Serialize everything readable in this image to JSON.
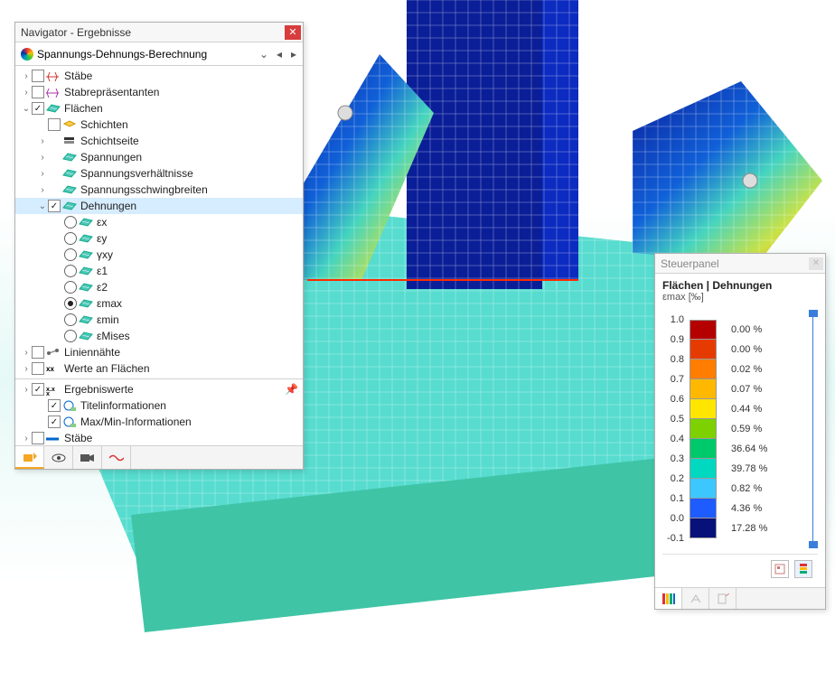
{
  "navigator": {
    "title": "Navigator - Ergebnisse",
    "dropdown": "Spannungs-Dehnungs-Berechnung",
    "tree": [
      {
        "d": 0,
        "exp": ">",
        "chk": false,
        "icon": "beam",
        "label": "Stäbe"
      },
      {
        "d": 0,
        "exp": ">",
        "chk": false,
        "icon": "beam2",
        "label": "Stabrepräsentanten"
      },
      {
        "d": 0,
        "exp": "v",
        "chk": true,
        "icon": "surf",
        "label": "Flächen"
      },
      {
        "d": 1,
        "chk": false,
        "icon": "layer",
        "label": "Schichten"
      },
      {
        "d": 1,
        "exp": ">",
        "icon": "side",
        "label": "Schichtseite"
      },
      {
        "d": 1,
        "exp": ">",
        "icon": "surf",
        "label": "Spannungen"
      },
      {
        "d": 1,
        "exp": ">",
        "icon": "surf",
        "label": "Spannungsverhältnisse"
      },
      {
        "d": 1,
        "exp": ">",
        "icon": "surf",
        "label": "Spannungsschwingbreiten"
      },
      {
        "d": 1,
        "exp": "v",
        "chk": true,
        "icon": "surf",
        "label": "Dehnungen",
        "sel": true
      },
      {
        "d": 2,
        "radio": false,
        "icon": "surf",
        "label": "εx"
      },
      {
        "d": 2,
        "radio": false,
        "icon": "surf",
        "label": "εy"
      },
      {
        "d": 2,
        "radio": false,
        "icon": "surf",
        "label": "γxy"
      },
      {
        "d": 2,
        "radio": false,
        "icon": "surf",
        "label": "ε1"
      },
      {
        "d": 2,
        "radio": false,
        "icon": "surf",
        "label": "ε2"
      },
      {
        "d": 2,
        "radio": true,
        "icon": "surf",
        "label": "εmax"
      },
      {
        "d": 2,
        "radio": false,
        "icon": "surf",
        "label": "εmin"
      },
      {
        "d": 2,
        "radio": false,
        "icon": "surf",
        "label": "εMises"
      },
      {
        "d": 0,
        "exp": ">",
        "chk": false,
        "icon": "line",
        "label": "Liniennähte"
      },
      {
        "d": 0,
        "exp": ">",
        "chk": false,
        "icon": "xx",
        "label": "Werte an Flächen"
      },
      {
        "divider": true
      },
      {
        "d": 0,
        "exp": ">",
        "chk": true,
        "icon": "xxx",
        "label": "Ergebniswerte",
        "pin": true
      },
      {
        "d": 1,
        "chk": true,
        "icon": "info",
        "label": "Titelinformationen"
      },
      {
        "d": 1,
        "chk": true,
        "icon": "info",
        "label": "Max/Min-Informationen"
      },
      {
        "d": 0,
        "exp": ">",
        "chk": false,
        "icon": "beam3",
        "label": "Stäbe"
      }
    ]
  },
  "ctrl": {
    "title": "Steuerpanel",
    "heading": "Flächen | Dehnungen",
    "sub": "εmax [‰]",
    "ticks": [
      "1.0",
      "0.9",
      "0.8",
      "0.7",
      "0.6",
      "0.5",
      "0.4",
      "0.3",
      "0.2",
      "0.1",
      "0.0",
      "-0.1"
    ],
    "colors": [
      "#b50000",
      "#e63b00",
      "#ff7d00",
      "#ffb800",
      "#ffe600",
      "#7dd100",
      "#00c96b",
      "#00d8c0",
      "#3cc8ff",
      "#1e5cff",
      "#08117a"
    ],
    "pcts": [
      "0.00 %",
      "0.00 %",
      "0.02 %",
      "0.07 %",
      "0.44 %",
      "0.59 %",
      "36.64 %",
      "39.78 %",
      "0.82 %",
      "4.36 %",
      "17.28 %"
    ]
  }
}
